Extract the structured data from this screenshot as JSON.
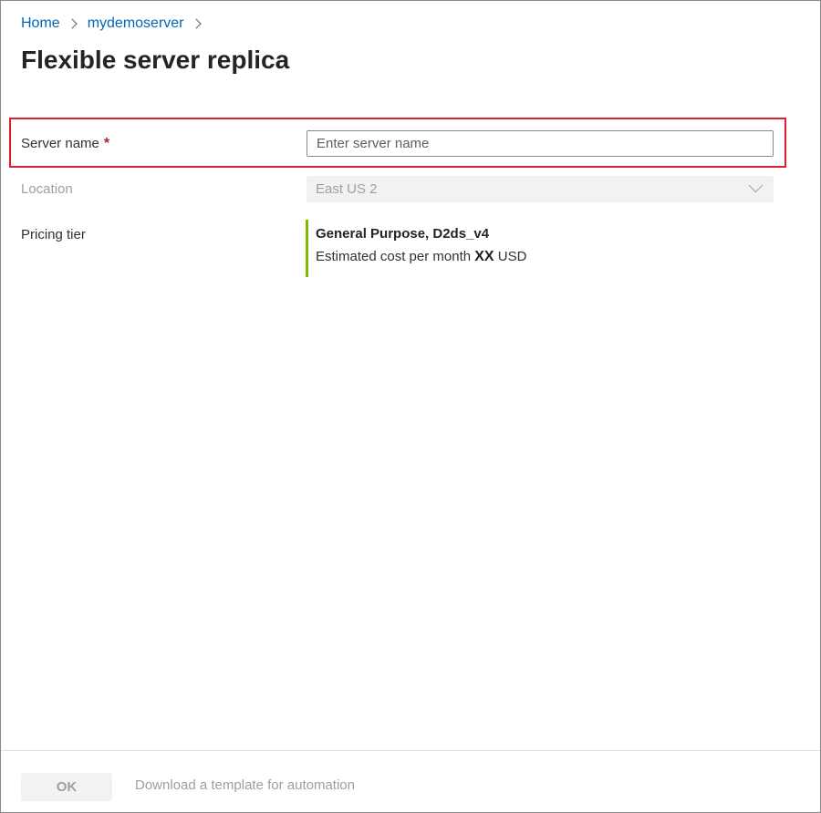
{
  "breadcrumb": {
    "items": [
      {
        "label": "Home"
      },
      {
        "label": "mydemoserver"
      }
    ]
  },
  "page": {
    "title": "Flexible server replica"
  },
  "form": {
    "server_name": {
      "label": "Server name",
      "required_marker": "*",
      "placeholder": "Enter server name",
      "value": ""
    },
    "location": {
      "label": "Location",
      "selected": "East US 2",
      "disabled": true
    },
    "pricing_tier": {
      "label": "Pricing tier",
      "tier_name": "General Purpose, D2ds_v4",
      "cost_prefix": "Estimated cost per month",
      "cost_value": "XX",
      "cost_currency": "USD"
    }
  },
  "footer": {
    "ok_label": "OK",
    "download_label": "Download a template for automation"
  },
  "colors": {
    "link": "#0067b8",
    "highlight_border": "#e01f2c",
    "required": "#a4262c",
    "pricing_accent": "#7fba00",
    "disabled_text": "#a19f9d",
    "disabled_bg": "#f3f2f1"
  }
}
